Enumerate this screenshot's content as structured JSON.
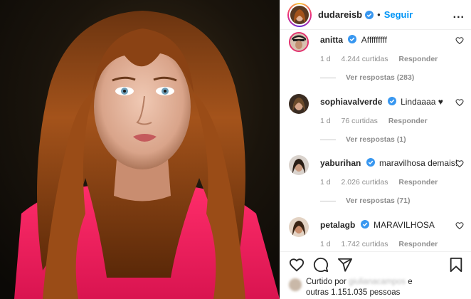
{
  "post": {
    "author": "dudareisb",
    "follow_label": "Seguir",
    "dot": "•",
    "more": "..."
  },
  "comments": [
    {
      "user": "anitta",
      "text": "Afffffffff",
      "age": "1 d",
      "likes": "4.244 curtidas",
      "reply_label": "Responder",
      "replies": "Ver respostas (283)"
    },
    {
      "user": "sophiavalverde",
      "text": "Lindaaaa ♥",
      "age": "1 d",
      "likes": "76 curtidas",
      "reply_label": "Responder",
      "replies": "Ver respostas (1)"
    },
    {
      "user": "yaburihan",
      "text": "maravilhosa demais!",
      "age": "1 d",
      "likes": "2.026 curtidas",
      "reply_label": "Responder",
      "replies": "Ver respostas (71)"
    },
    {
      "user": "petalagb",
      "text": "MARAVILHOSA",
      "age": "1 d",
      "likes": "1.742 curtidas",
      "reply_label": "Responder"
    }
  ],
  "likes_summary": {
    "prefix": "Curtido por",
    "blurred_user": "giulianacampos",
    "connector": "e",
    "others": "outras 1.151.035 pessoas"
  },
  "icons": {
    "verified": "verified-badge-icon",
    "like": "heart-icon",
    "comment": "comment-bubble-icon",
    "share": "paper-plane-icon",
    "save": "bookmark-icon"
  },
  "colors": {
    "accent": "#0095f6",
    "verified": "#3897f0",
    "muted": "#8e8e8e"
  }
}
